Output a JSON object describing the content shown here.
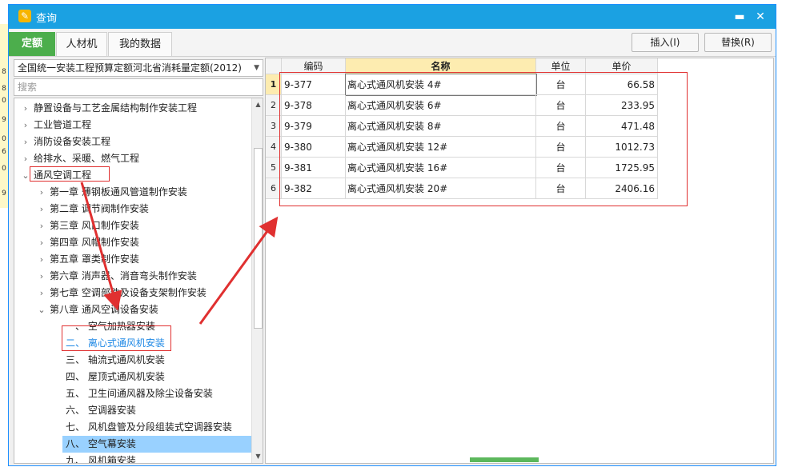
{
  "dialog": {
    "title": "查询",
    "minimize_glyph": "▬",
    "close_glyph": "✕"
  },
  "tabs": [
    {
      "label": "定额",
      "active": true
    },
    {
      "label": "人材机",
      "active": false
    },
    {
      "label": "我的数据",
      "active": false
    }
  ],
  "actions": {
    "insert_label": "插入(I)",
    "replace_label": "替换(R)"
  },
  "left": {
    "quota_library": "全国统一安装工程预算定额河北省消耗量定额(2012)",
    "search_placeholder": "搜索",
    "tree": [
      {
        "level": 0,
        "label": "静置设备与工艺金属结构制作安装工程",
        "expanded": false
      },
      {
        "level": 0,
        "label": "工业管道工程",
        "expanded": false
      },
      {
        "level": 0,
        "label": "消防设备安装工程",
        "expanded": false
      },
      {
        "level": 0,
        "label": "给排水、采暖、燃气工程",
        "expanded": false
      },
      {
        "level": 0,
        "label": "通风空调工程",
        "expanded": true
      },
      {
        "level": 1,
        "label": "第一章  薄钢板通风管道制作安装",
        "expanded": false
      },
      {
        "level": 1,
        "label": "第二章  调节阀制作安装",
        "expanded": false
      },
      {
        "level": 1,
        "label": "第三章  风口制作安装",
        "expanded": false
      },
      {
        "level": 1,
        "label": "第四章  风帽制作安装",
        "expanded": false
      },
      {
        "level": 1,
        "label": "第五章  罩类制作安装",
        "expanded": false
      },
      {
        "level": 1,
        "label": "第六章  消声器、消音弯头制作安装",
        "expanded": false
      },
      {
        "level": 1,
        "label": "第七章  空调部件及设备支架制作安装",
        "expanded": false
      },
      {
        "level": 1,
        "label": "第八章  通风空调设备安装",
        "expanded": true
      },
      {
        "level": 2,
        "label": "一、  空气加热器安装"
      },
      {
        "level": 2,
        "label": "二、  离心式通风机安装",
        "highlighted": true
      },
      {
        "level": 2,
        "label": "三、  轴流式通风机安装"
      },
      {
        "level": 2,
        "label": "四、  屋顶式通风机安装"
      },
      {
        "level": 2,
        "label": "五、  卫生间通风器及除尘设备安装"
      },
      {
        "level": 2,
        "label": "六、  空调器安装"
      },
      {
        "level": 2,
        "label": "七、  风机盘管及分段组装式空调器安装"
      },
      {
        "level": 2,
        "label": "八、  空气幕安装",
        "selected": true
      },
      {
        "level": 2,
        "label": "九、  风机箱安装"
      }
    ]
  },
  "grid": {
    "columns": [
      "编码",
      "名称",
      "单位",
      "单价"
    ],
    "rows": [
      {
        "n": "1",
        "code": "9-377",
        "name": "离心式通风机安装  4#",
        "unit": "台",
        "price": "66.58"
      },
      {
        "n": "2",
        "code": "9-378",
        "name": "离心式通风机安装  6#",
        "unit": "台",
        "price": "233.95"
      },
      {
        "n": "3",
        "code": "9-379",
        "name": "离心式通风机安装  8#",
        "unit": "台",
        "price": "471.48"
      },
      {
        "n": "4",
        "code": "9-380",
        "name": "离心式通风机安装  12#",
        "unit": "台",
        "price": "1012.73"
      },
      {
        "n": "5",
        "code": "9-381",
        "name": "离心式通风机安装  16#",
        "unit": "台",
        "price": "1725.95"
      },
      {
        "n": "6",
        "code": "9-382",
        "name": "离心式通风机安装  20#",
        "unit": "台",
        "price": "2406.16"
      }
    ]
  },
  "background_numbers": [
    "8",
    "8",
    "0",
    "9",
    "0",
    "6",
    "0",
    "9"
  ],
  "colors": {
    "titlebar": "#1ba1e2",
    "tab_active": "#4cae4c",
    "selected_row": "#99d1ff",
    "highlight_text": "#1e88e5",
    "annotation": "#e03030"
  }
}
